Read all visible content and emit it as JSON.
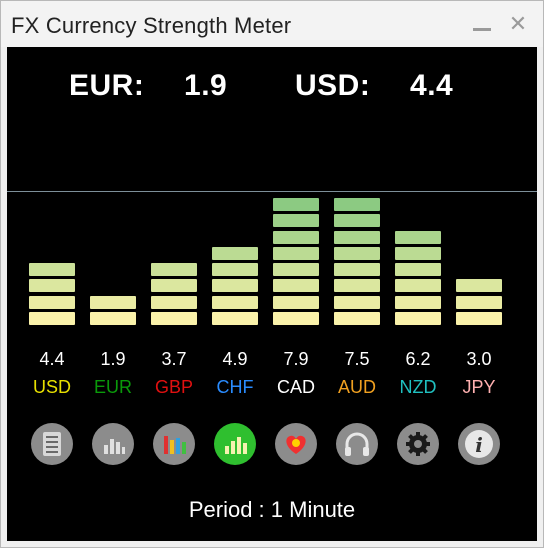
{
  "window": {
    "title": "FX Currency Strength Meter",
    "minimize_label": "—",
    "close_label": "✕"
  },
  "pair": {
    "base": {
      "code": "EUR:",
      "value": "1.9"
    },
    "quote": {
      "code": "USD:",
      "value": "4.4"
    }
  },
  "currencies": [
    {
      "code": "USD",
      "value": "4.4",
      "strength": 4.4,
      "color": "#e8e000"
    },
    {
      "code": "EUR",
      "value": "1.9",
      "strength": 1.9,
      "color": "#0a9a0a"
    },
    {
      "code": "GBP",
      "value": "3.7",
      "strength": 3.7,
      "color": "#e01010"
    },
    {
      "code": "CHF",
      "value": "4.9",
      "strength": 4.9,
      "color": "#2a8cff"
    },
    {
      "code": "CAD",
      "value": "7.9",
      "strength": 7.9,
      "color": "#ffffff"
    },
    {
      "code": "AUD",
      "value": "7.5",
      "strength": 7.5,
      "color": "#f0a020"
    },
    {
      "code": "NZD",
      "value": "6.2",
      "strength": 6.2,
      "color": "#20c0c0"
    },
    {
      "code": "JPY",
      "value": "3.0",
      "strength": 3.0,
      "color": "#ffb0b0"
    }
  ],
  "toolbar": [
    {
      "name": "list-icon",
      "active": false
    },
    {
      "name": "bar-chart-icon",
      "active": false
    },
    {
      "name": "color-bars-icon",
      "active": false
    },
    {
      "name": "strength-meter-icon",
      "active": true
    },
    {
      "name": "heatmap-icon",
      "active": false
    },
    {
      "name": "headphones-icon",
      "active": false
    },
    {
      "name": "gear-icon",
      "active": false
    },
    {
      "name": "info-icon",
      "active": false
    }
  ],
  "period": "Period : 1 Minute"
}
